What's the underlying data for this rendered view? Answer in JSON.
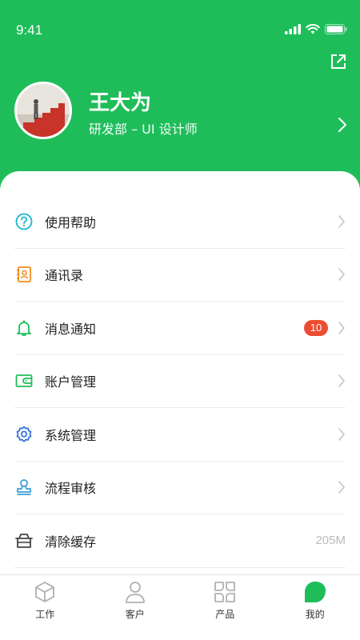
{
  "status_bar": {
    "time": "9:41"
  },
  "profile": {
    "name": "王大为",
    "department": "研发部 – UI 设计师"
  },
  "menu": [
    {
      "label": "使用帮助",
      "icon": "help-circle-icon"
    },
    {
      "label": "通讯录",
      "icon": "contacts-book-icon"
    },
    {
      "label": "消息通知",
      "icon": "bell-icon",
      "badge": "10"
    },
    {
      "label": "账户管理",
      "icon": "wallet-icon"
    },
    {
      "label": "系统管理",
      "icon": "gear-icon"
    },
    {
      "label": "流程审核",
      "icon": "stamp-icon"
    },
    {
      "label": "清除缓存",
      "icon": "cache-basket-icon",
      "value": "205M"
    }
  ],
  "tabs": [
    {
      "label": "工作",
      "icon": "cube-icon"
    },
    {
      "label": "客户",
      "icon": "person-icon"
    },
    {
      "label": "产品",
      "icon": "grid-icon"
    },
    {
      "label": "我的",
      "icon": "leaf-icon",
      "active": true
    }
  ],
  "colors": {
    "brand": "#1fbd5a",
    "badge": "#ec4d32",
    "icon_help": "#17b6c9",
    "icon_contacts": "#f08c1e",
    "icon_bell": "#1fbd5a",
    "icon_wallet": "#1fbd5a",
    "icon_gear": "#2f6fd6",
    "icon_stamp": "#3a9ed6",
    "icon_cache": "#444444"
  }
}
